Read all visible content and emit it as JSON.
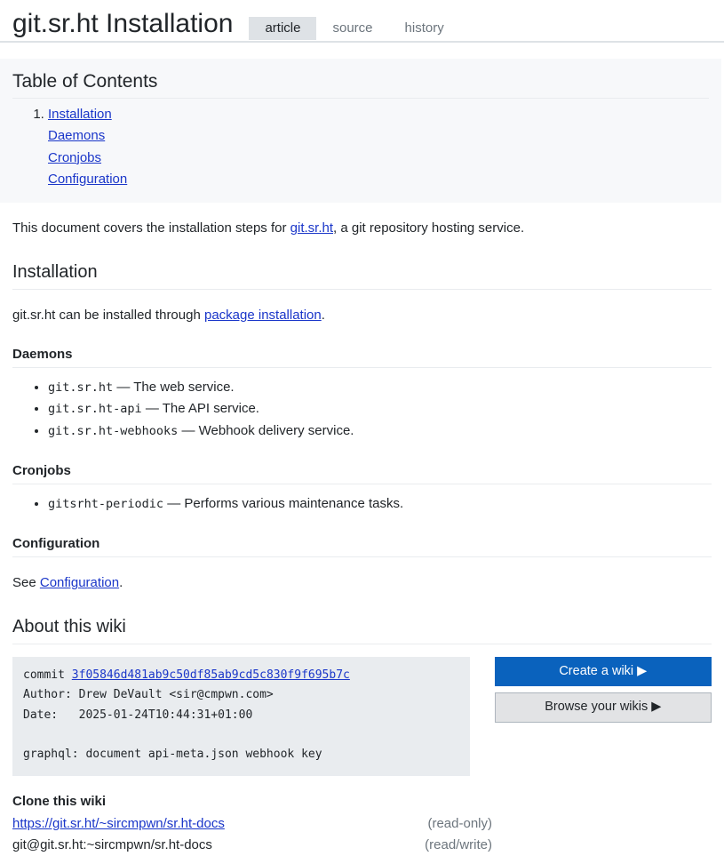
{
  "header": {
    "title": "git.sr.ht Installation",
    "tabs": [
      {
        "label": "article",
        "active": true
      },
      {
        "label": "source",
        "active": false
      },
      {
        "label": "history",
        "active": false
      }
    ]
  },
  "toc": {
    "title": "Table of Contents",
    "items": [
      {
        "number": "1.",
        "label": "Installation"
      }
    ],
    "subitems": [
      {
        "label": "Daemons"
      },
      {
        "label": "Cronjobs"
      },
      {
        "label": "Configuration"
      }
    ]
  },
  "intro": {
    "before": "This document covers the installation steps for ",
    "link": "git.sr.ht",
    "after": ", a git repository hosting service."
  },
  "installation": {
    "heading": "Installation",
    "paragraph_before": "git.sr.ht can be installed through ",
    "paragraph_link": "package installation",
    "paragraph_after": "."
  },
  "daemons": {
    "heading": "Daemons",
    "items": [
      {
        "code": "git.sr.ht",
        "desc": " — The web service."
      },
      {
        "code": "git.sr.ht-api",
        "desc": " — The API service."
      },
      {
        "code": "git.sr.ht-webhooks",
        "desc": " — Webhook delivery service."
      }
    ]
  },
  "cronjobs": {
    "heading": "Cronjobs",
    "items": [
      {
        "code": "gitsrht-periodic",
        "desc": " — Performs various maintenance tasks."
      }
    ]
  },
  "configuration": {
    "heading": "Configuration",
    "paragraph_before": "See ",
    "paragraph_link": "Configuration",
    "paragraph_after": "."
  },
  "about": {
    "heading": "About this wiki",
    "commit_label": "commit ",
    "commit_hash": "3f05846d481ab9c50df85ab9cd5c830f9f695b7c",
    "author_line": "Author: Drew DeVault <sir@cmpwn.com>",
    "date_line": "Date:   2025-01-24T10:44:31+01:00",
    "message_line": "graphql: document api-meta.json webhook key",
    "buttons": [
      {
        "label": "Create a wiki",
        "arrow": "▶",
        "style": "primary"
      },
      {
        "label": "Browse your wikis",
        "arrow": "▶",
        "style": "secondary"
      }
    ]
  },
  "clone": {
    "heading": "Clone this wiki",
    "rows": [
      {
        "url": "https://git.sr.ht/~sircmpwn/sr.ht-docs",
        "access": "(read-only)",
        "is_link": true
      },
      {
        "url": "git@git.sr.ht:~sircmpwn/sr.ht-docs",
        "access": "(read/write)",
        "is_link": false
      }
    ]
  },
  "colors": {
    "link": "#1a36c9",
    "primary": "#0a62bd",
    "secondary": "#e2e3e5",
    "code_bg": "#e9ecef",
    "toc_bg": "#f7f8fa"
  }
}
